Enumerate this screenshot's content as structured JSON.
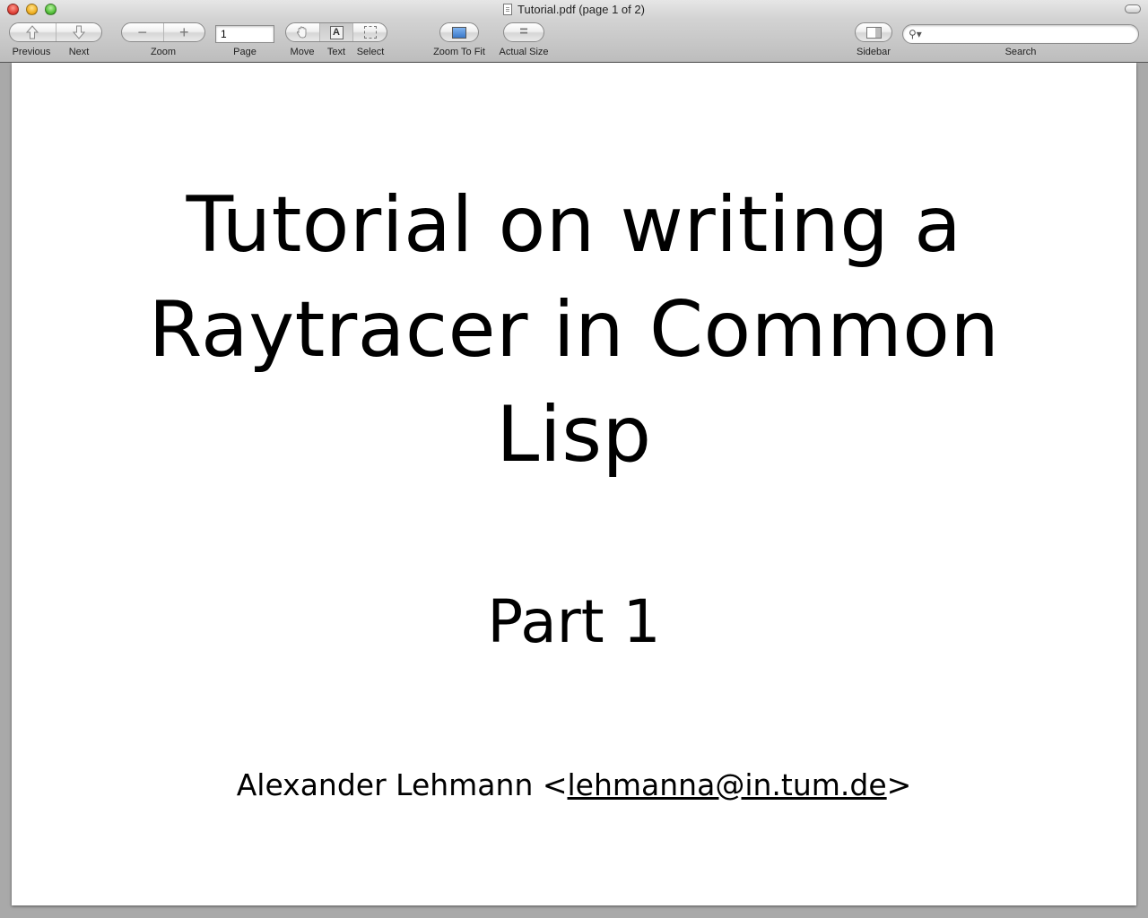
{
  "window": {
    "title": "Tutorial.pdf (page 1 of 2)"
  },
  "toolbar": {
    "previous_label": "Previous",
    "next_label": "Next",
    "zoom_label": "Zoom",
    "page_label": "Page",
    "page_value": "1",
    "move_label": "Move",
    "text_label": "Text",
    "select_label": "Select",
    "zoom_to_fit_label": "Zoom To Fit",
    "actual_size_label": "Actual Size",
    "sidebar_label": "Sidebar",
    "search_label": "Search",
    "search_value": "",
    "zoom_out_glyph": "−",
    "zoom_in_glyph": "+",
    "text_tool_glyph": "A",
    "actual_size_glyph": "="
  },
  "document": {
    "title_lines": [
      "Tutorial on writing a",
      "Raytracer in Common",
      "Lisp"
    ],
    "part": "Part 1",
    "author_prefix": "Alexander Lehmann <",
    "author_email": "lehmanna@in.tum.de",
    "author_suffix": ">"
  }
}
